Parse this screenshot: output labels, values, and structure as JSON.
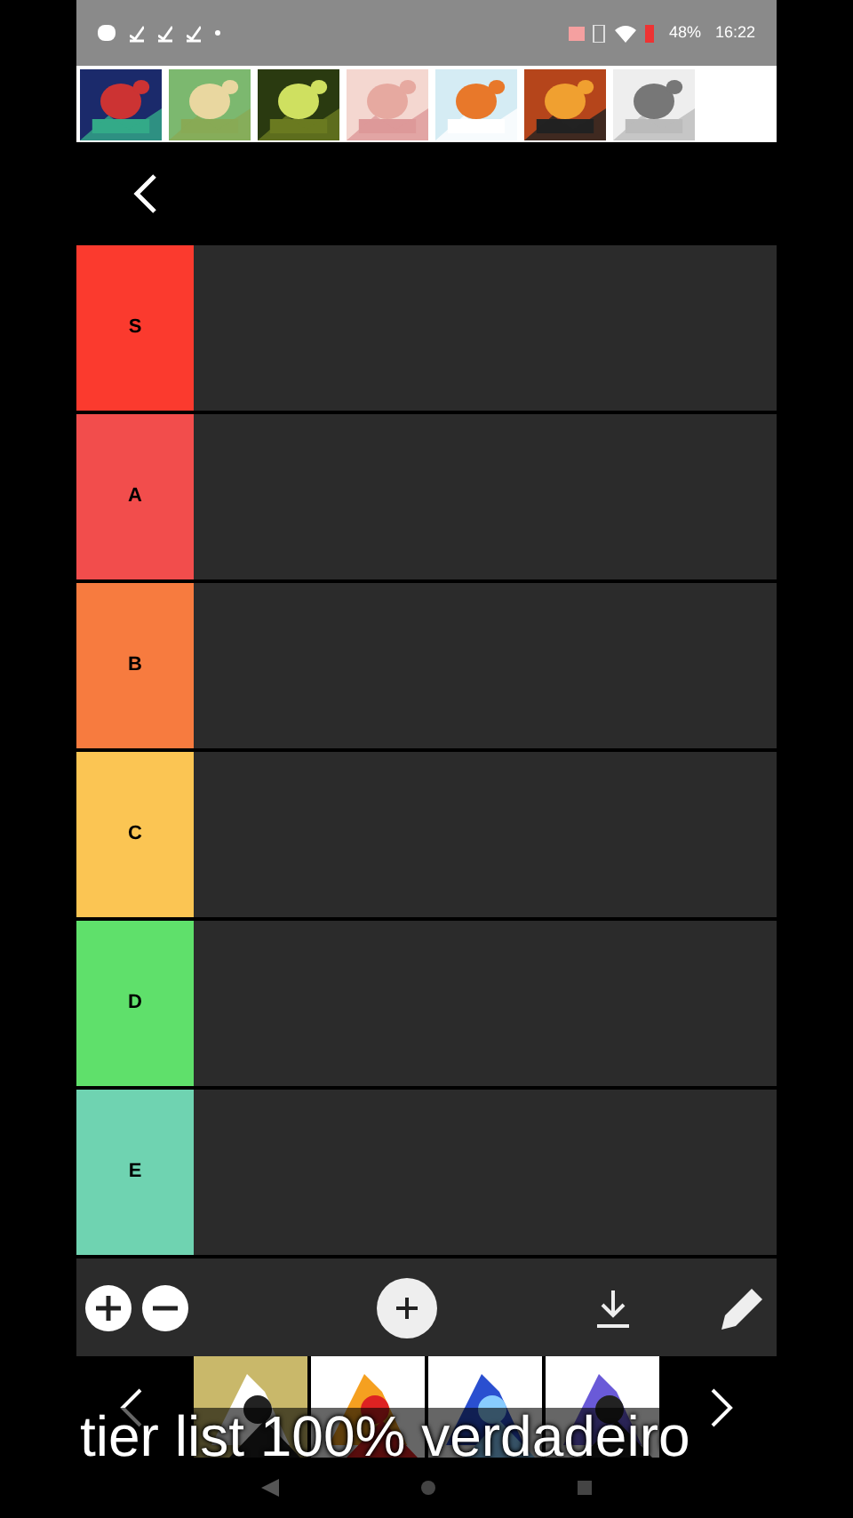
{
  "status_bar": {
    "battery": "48%",
    "time": "16:22"
  },
  "tiers": [
    {
      "label": "S",
      "color": "#fb3a2e"
    },
    {
      "label": "A",
      "color": "#f24d4c"
    },
    {
      "label": "B",
      "color": "#f77b3f"
    },
    {
      "label": "C",
      "color": "#fbc553"
    },
    {
      "label": "D",
      "color": "#5fe06b"
    },
    {
      "label": "E",
      "color": "#6fd3b1"
    }
  ],
  "caption": "tier list 100% verdadeiro"
}
